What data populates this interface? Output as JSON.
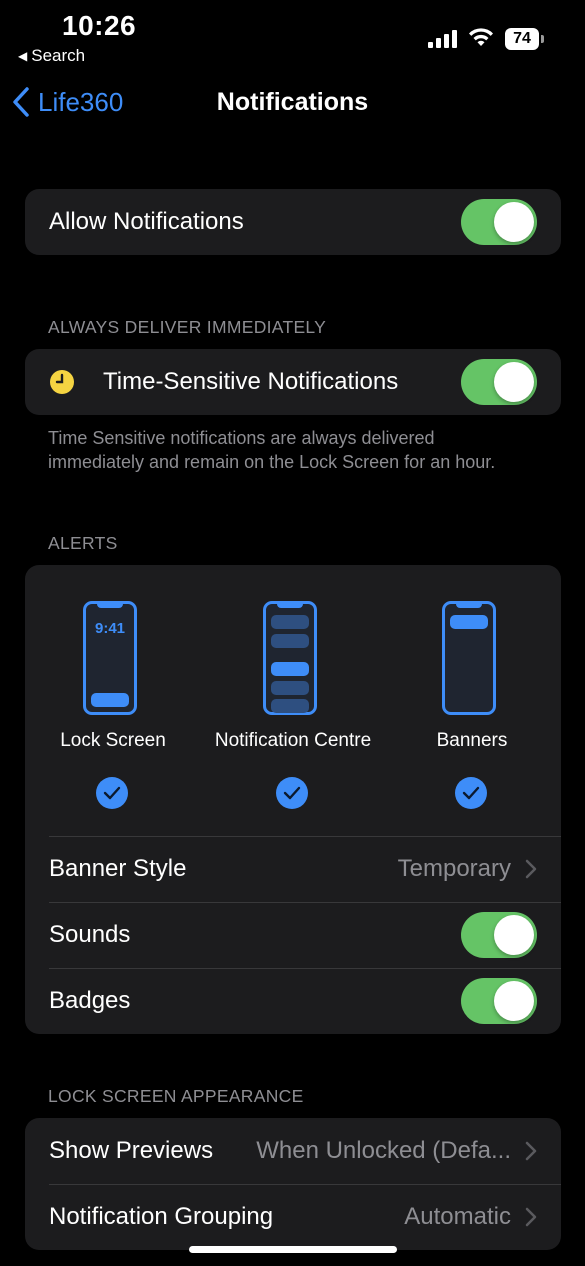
{
  "status": {
    "time": "10:26",
    "back_app": "Search",
    "battery": "74"
  },
  "nav": {
    "back_label": "Life360",
    "title": "Notifications"
  },
  "allow": {
    "label": "Allow Notifications",
    "on": true
  },
  "always_deliver": {
    "header": "ALWAYS DELIVER IMMEDIATELY",
    "label": "Time-Sensitive Notifications",
    "on": true,
    "footnote": "Time Sensitive notifications are always delivered immediately and remain on the Lock Screen for an hour."
  },
  "alerts": {
    "header": "ALERTS",
    "options": [
      {
        "label": "Lock Screen",
        "preview_time": "9:41",
        "checked": true
      },
      {
        "label": "Notification Centre",
        "checked": true
      },
      {
        "label": "Banners",
        "checked": true
      }
    ],
    "banner_style": {
      "label": "Banner Style",
      "value": "Temporary"
    },
    "sounds": {
      "label": "Sounds",
      "on": true
    },
    "badges": {
      "label": "Badges",
      "on": true
    }
  },
  "lock_screen": {
    "header": "LOCK SCREEN APPEARANCE",
    "show_previews": {
      "label": "Show Previews",
      "value": "When Unlocked (Defa..."
    },
    "grouping": {
      "label": "Notification Grouping",
      "value": "Automatic"
    }
  },
  "colors": {
    "accent": "#3e8df8",
    "toggle_on": "#65c466",
    "group_bg": "#1c1c1e",
    "secondary_text": "#8e8e93"
  }
}
